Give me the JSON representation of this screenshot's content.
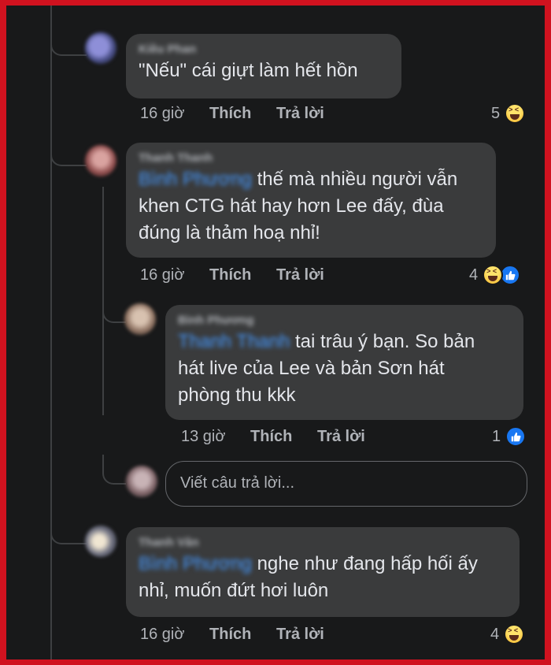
{
  "colors": {
    "border": "#d0121f",
    "background": "#18191a",
    "bubble": "#3a3b3c",
    "mention": "#4599ff",
    "like": "#1877f2"
  },
  "comments": [
    {
      "author": "Kiều Phan",
      "text": "\"Nếu\" cái giựt làm hết hồn",
      "time": "16 giờ",
      "like_label": "Thích",
      "reply_label": "Trả lời",
      "reaction_count": "5",
      "reactions": [
        "haha-icon"
      ]
    },
    {
      "author": "Thanh Thanh",
      "mention": "Bình Phương",
      "text": "thế mà nhiều người vẫn khen CTG hát hay hơn Lee đấy, đùa đúng là thảm hoạ nhỉ!",
      "line1": "thế mà nhiều người vẫn",
      "line2": "khen CTG hát hay hơn Lee đấy, đùa",
      "line3": "đúng là thảm hoạ nhỉ!",
      "time": "16 giờ",
      "like_label": "Thích",
      "reply_label": "Trả lời",
      "reaction_count": "4",
      "reactions": [
        "haha-icon",
        "like-icon"
      ]
    },
    {
      "author": "Bình Phương",
      "mention": "Thanh Thanh",
      "line1": "tai trâu ý bạn. So bản",
      "line2": "hát live của Lee và bản Sơn hát",
      "line3": "phòng thu kkk",
      "time": "13 giờ",
      "like_label": "Thích",
      "reply_label": "Trả lời",
      "reaction_count": "1",
      "reactions": [
        "like-icon"
      ]
    },
    {
      "author": "Thanh Vân",
      "mention": "Bình Phương",
      "line1": "nghe như đang hấp hối ấy",
      "line2": "nhỉ, muốn đứt hơi luôn",
      "time": "16 giờ",
      "like_label": "Thích",
      "reply_label": "Trả lời",
      "reaction_count": "4",
      "reactions": [
        "haha-icon"
      ]
    }
  ],
  "reply_box": {
    "placeholder": "Viết câu trả lời..."
  }
}
